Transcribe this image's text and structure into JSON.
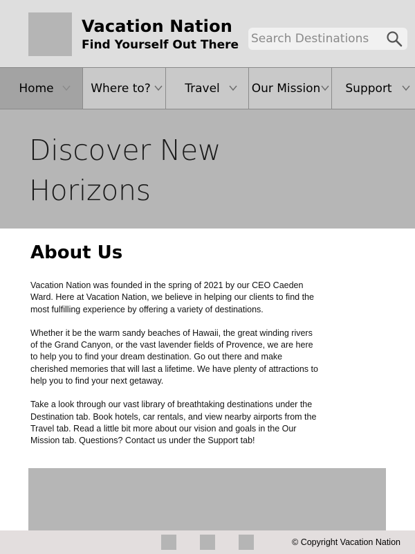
{
  "header": {
    "brand_title": "Vacation Nation",
    "brand_tagline": "Find Yourself Out There",
    "search": {
      "placeholder": "Search Destinations",
      "value": ""
    },
    "icons": {
      "logo": "logo-placeholder",
      "search": "search-icon"
    }
  },
  "nav": {
    "items": [
      {
        "label": "Home",
        "active": true
      },
      {
        "label": "Where to?",
        "active": false
      },
      {
        "label": "Travel",
        "active": false
      },
      {
        "label": "Our Mission",
        "active": false
      },
      {
        "label": "Support",
        "active": false
      }
    ],
    "dropdown_icon": "chevron-down-icon"
  },
  "hero": {
    "title": "Discover New Horizons"
  },
  "about": {
    "heading": "About Us",
    "paragraphs": [
      "Vacation Nation was founded in the spring of 2021 by our CEO Caeden Ward. Here at Vacation Nation, we believe in helping our clients to find the most fulfilling experience by offering a variety of destinations.",
      "Whether it be the warm sandy beaches of Hawaii, the great winding rivers of the Grand Canyon, or the vast lavender fields of Provence, we are here to help you to find your dream destination. Go out there and make cherished memories that will last a lifetime. We have plenty of attractions to help you to find your next getaway.",
      "Take a look through our vast library of breathtaking destinations under the Destination tab. Book hotels, car rentals, and view nearby airports from the Travel tab. Read a little bit more about our vision and goals in the Our Mission tab. Questions? Contact us under the Support tab!"
    ]
  },
  "footer": {
    "copyright": "© Copyright Vacation Nation",
    "social_icons": [
      "social-icon",
      "social-icon",
      "social-icon"
    ]
  },
  "colors": {
    "header_bg": "#dedede",
    "nav_bg": "#c9c9c9",
    "nav_active_bg": "#a3a3a3",
    "hero_bg": "#b6b6b6",
    "footer_bg": "#e3dede",
    "placeholder_gray": "#b5b5b5"
  }
}
